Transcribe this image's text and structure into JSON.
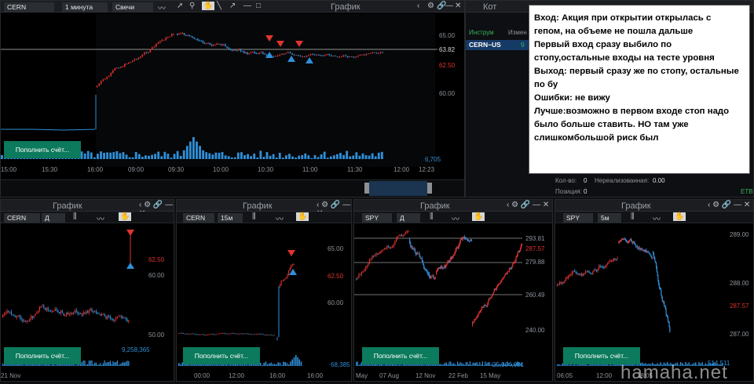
{
  "main": {
    "symbol": "CERN",
    "interval": "1 минута",
    "chart_type": "Свечи",
    "title": "График",
    "price_ticks": [
      "65.00",
      "63.82",
      "62.50",
      "60.00"
    ],
    "volume_label": "6,705",
    "time_ticks": [
      "15:00",
      "15:30",
      "16:00",
      "09:00",
      "09:30",
      "10:00",
      "10:30",
      "11:00",
      "11:30",
      "12:00",
      "12:23"
    ],
    "deposit_button": "Пополнить счёт..."
  },
  "quotes": {
    "title": "Кот",
    "col1": "Инструм",
    "col2": "Измен",
    "row_symbol": "CERN~US",
    "row_value": "9"
  },
  "position": {
    "qty_label": "Кол-во:",
    "qty_value": "0",
    "unreal_label": "Нереализованная:",
    "unreal_value": "0.00",
    "pos_label": "Позиция:",
    "pos_value": "0",
    "exchange": "ETB"
  },
  "note": {
    "lines": [
      "Вход: Акция при открытии открылась с",
      "гепом, на объеме не пошла дальше",
      "Первый вход сразу выбило по",
      "стопу,остальные входы на тесте уровня",
      "Выход: первый сразу же по стопу, остальные",
      "по бу",
      "Ошибки: не вижу",
      "Лучше:возможно в первом входе стоп надо",
      "было больше ставить. НО там уже",
      "слишкомбольшой риск был"
    ]
  },
  "p1": {
    "title": "График",
    "symbol": "CERN",
    "interval": "Д",
    "ticks": [
      "62.50",
      "60.00",
      "50.00"
    ],
    "volume": "9,258,365",
    "xlabel": "21 Nov",
    "button": "Пополнить счёт..."
  },
  "p2": {
    "title": "График",
    "symbol": "CERN",
    "interval": "15м",
    "ticks": [
      "65.00",
      "62.50",
      "60.00"
    ],
    "volume": "68,385",
    "xticks": [
      "00:00",
      "12:00",
      "16:00",
      "16:00"
    ],
    "button": "Пополнить счёт..."
  },
  "p3": {
    "title": "График",
    "symbol": "SPY",
    "interval": "Д",
    "ticks": [
      "293.81",
      "287.57",
      "279.88",
      "260.49",
      "240.00"
    ],
    "volume": "25,964,081",
    "xticks": [
      "May",
      "07 Aug",
      "12 Nov",
      "22 Feb",
      "15 May"
    ],
    "button": "Пополнить счёт..."
  },
  "p4": {
    "title": "График",
    "symbol": "SPY",
    "interval": "5м",
    "ticks": [
      "289.00",
      "288.00",
      "287.57",
      "287.00"
    ],
    "volume": "514,511",
    "xticks": [
      "06:05",
      "12:00",
      "18:05"
    ],
    "button": "Пополнить счёт..."
  },
  "watermark": "hamaha.net",
  "colors": {
    "up": "#2f8fd8",
    "down": "#e0332f",
    "button": "#0c7a5c"
  }
}
